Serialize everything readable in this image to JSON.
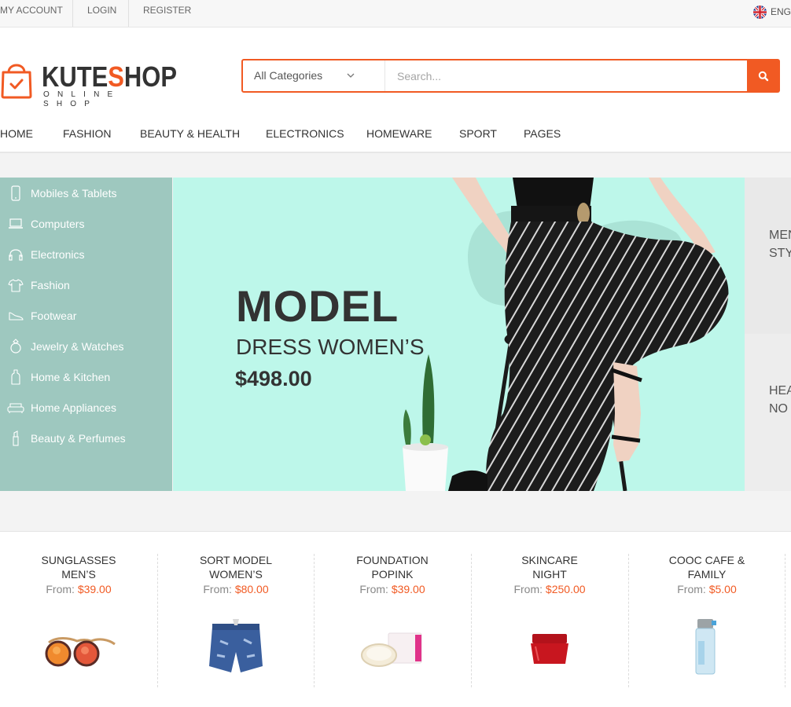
{
  "topbar": {
    "my_account": "MY ACCOUNT",
    "login": "LOGIN",
    "register": "REGISTER",
    "language": "ENG"
  },
  "logo": {
    "name_part1": "KUTE",
    "name_accent": "S",
    "name_part2": "HOP",
    "tagline": "ONLINE SHOP"
  },
  "search": {
    "category": "All Categories",
    "placeholder": "Search..."
  },
  "nav": [
    "HOME",
    "FASHION",
    "BEAUTY & HEALTH",
    "ELECTRONICS",
    "HOMEWARE",
    "SPORT",
    "PAGES"
  ],
  "categories": [
    {
      "label": "Mobiles & Tablets",
      "icon": "mobile-icon"
    },
    {
      "label": "Computers",
      "icon": "laptop-icon"
    },
    {
      "label": "Electronics",
      "icon": "headphones-icon"
    },
    {
      "label": "Fashion",
      "icon": "tshirt-icon"
    },
    {
      "label": "Footwear",
      "icon": "shoe-icon"
    },
    {
      "label": "Jewelry & Watches",
      "icon": "ring-icon"
    },
    {
      "label": "Home & Kitchen",
      "icon": "bottle-icon"
    },
    {
      "label": "Home Appliances",
      "icon": "sofa-icon"
    },
    {
      "label": "Beauty & Perfumes",
      "icon": "lipstick-icon"
    }
  ],
  "banner": {
    "title": "MODEL",
    "subtitle": "DRESS WOMEN’S",
    "price": "$498.00"
  },
  "side_promos": [
    {
      "line1": "MEN",
      "line2": "STY"
    },
    {
      "line1": "HEA",
      "line2": "NO"
    }
  ],
  "products": [
    {
      "name1": "SUNGLASSES",
      "name2": "MEN’S",
      "from": "From:",
      "price": "$39.00",
      "image": "sunglasses"
    },
    {
      "name1": "SORT MODEL",
      "name2": "WOMEN’S",
      "from": "From:",
      "price": "$80.00",
      "image": "denim-shorts"
    },
    {
      "name1": "FOUNDATION",
      "name2": "POPINK",
      "from": "From:",
      "price": "$39.00",
      "image": "cushion-compact"
    },
    {
      "name1": "SKINCARE",
      "name2": "NIGHT",
      "from": "From:",
      "price": "$250.00",
      "image": "cream-jar"
    },
    {
      "name1": "COOC CAFE &",
      "name2": "FAMILY",
      "from": "From:",
      "price": "$5.00",
      "image": "water-bottle"
    }
  ],
  "colors": {
    "accent": "#f15a23",
    "menu_bg": "#9ec8bf",
    "banner_bg": "#bdf7ea"
  }
}
